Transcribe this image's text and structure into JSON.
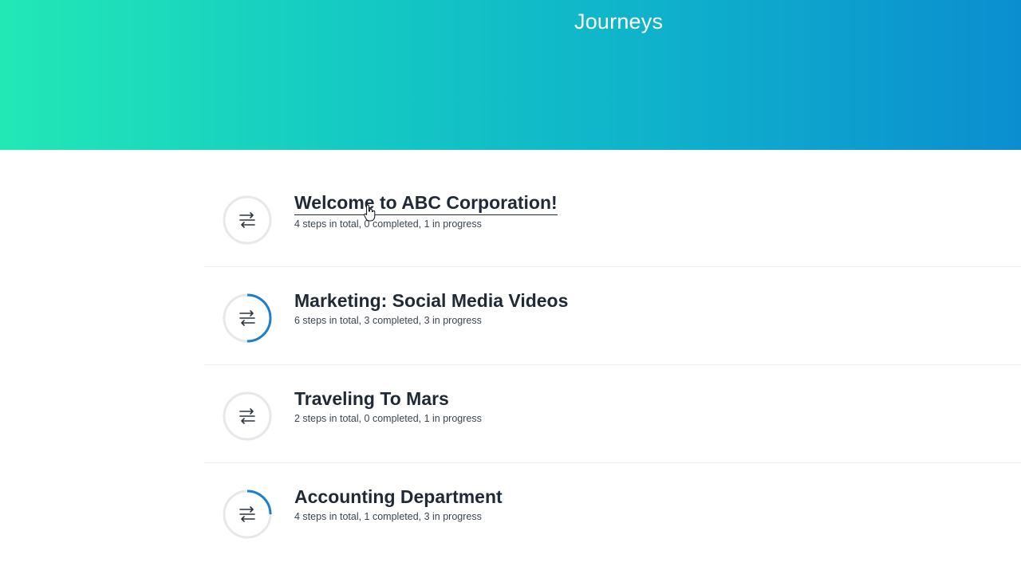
{
  "header": {
    "title": "Journeys",
    "gradient_start": "#22e8b6",
    "gradient_end": "#0b8ed0"
  },
  "journeys": [
    {
      "title": "Welcome to ABC Corporation!",
      "meta": "4 steps in total, 0 completed, 1 in progress",
      "progress": 0,
      "icon": "journey-route-icon"
    },
    {
      "title": "Marketing: Social Media Videos",
      "meta": "6 steps in total, 3 completed, 3 in progress",
      "progress": 0.5,
      "icon": "journey-route-icon"
    },
    {
      "title": "Traveling To Mars",
      "meta": "2 steps in total, 0 completed, 1 in progress",
      "progress": 0,
      "icon": "journey-route-icon"
    },
    {
      "title": "Accounting Department",
      "meta": "4 steps in total, 1 completed, 3 in progress",
      "progress": 0.25,
      "icon": "journey-route-icon"
    }
  ],
  "colors": {
    "progress_arc": "#1a7fd0",
    "ring_track": "#e6e8ea"
  }
}
